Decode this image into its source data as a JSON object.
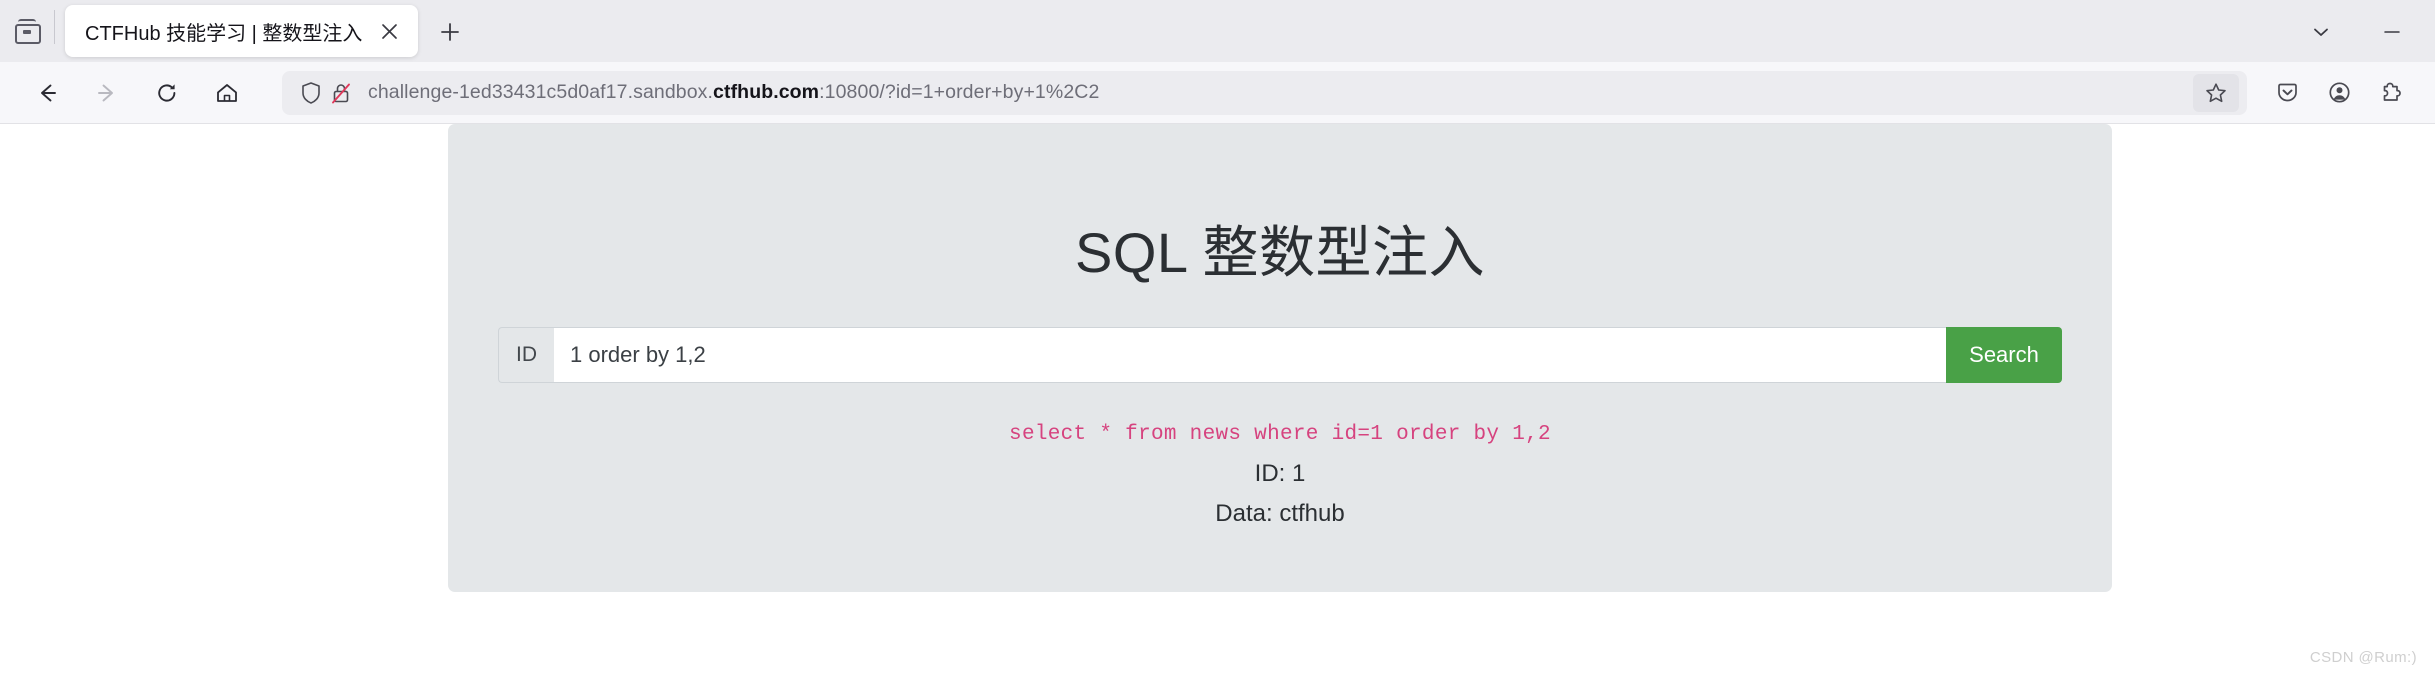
{
  "browser": {
    "firefox_view_icon": "firefox-view-icon",
    "tabs": [
      {
        "title": "CTFHub 技能学习 | 整数型注入",
        "close_icon": "close-icon",
        "active": true
      }
    ],
    "new_tab_icon": "plus-icon",
    "list_all_tabs_icon": "chevron-down-icon",
    "minimize_icon": "minimize-icon",
    "nav": {
      "back_icon": "back-arrow-icon",
      "forward_icon": "forward-arrow-icon",
      "reload_icon": "reload-icon",
      "home_icon": "home-icon"
    },
    "url_bar": {
      "shield_icon": "shield-icon",
      "lock_icon": "lock-crossed-icon",
      "url_prefix": "challenge-1ed33431c5d0af17.sandbox.",
      "url_host_bold": "ctfhub.com",
      "url_suffix": ":10800/?id=1+order+by+1%2C2",
      "full_url": "challenge-1ed33431c5d0af17.sandbox.ctfhub.com:10800/?id=1+order+by+1%2C2",
      "bookmark_icon": "star-icon"
    },
    "toolbar_right": {
      "pocket_icon": "pocket-save-icon",
      "account_icon": "account-circle-icon",
      "extensions_icon": "extensions-puzzle-icon"
    }
  },
  "page": {
    "heading": "SQL 整数型注入",
    "form": {
      "id_label": "ID",
      "id_value": "1 order by 1,2",
      "id_placeholder": "",
      "search_label": "Search",
      "search_color": "#49a147"
    },
    "output": {
      "sql_query": "select * from news where id=1 order by 1,2",
      "sql_color": "#d6437f",
      "result_id": "ID: 1",
      "result_data": "Data: ctfhub"
    },
    "panel_color": "#e4e7e9"
  },
  "watermark": "CSDN @Rum:)"
}
